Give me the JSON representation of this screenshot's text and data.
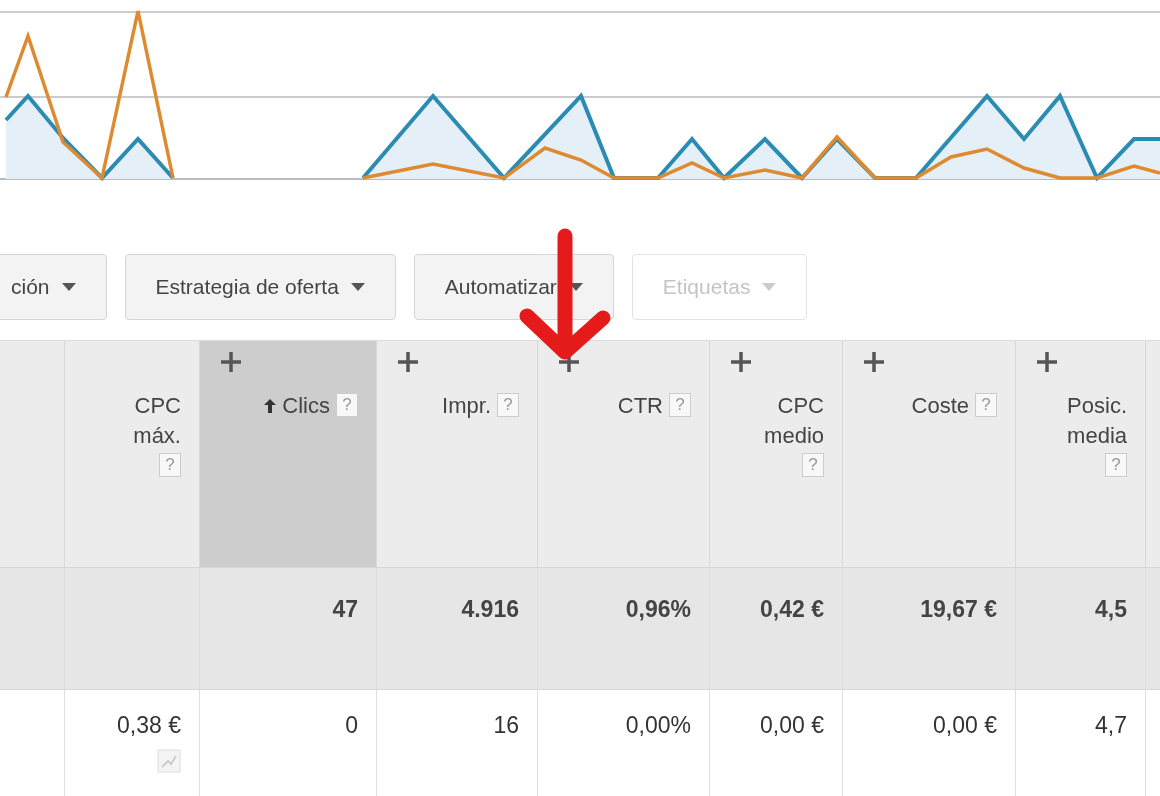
{
  "toolbar": {
    "buttons": [
      {
        "label": "ción",
        "disabled": false
      },
      {
        "label": "Estrategia de oferta",
        "disabled": false
      },
      {
        "label": "Automatizar",
        "disabled": false
      },
      {
        "label": "Etiquetas",
        "disabled": true
      }
    ]
  },
  "table": {
    "columns": [
      {
        "kind": "blank"
      },
      {
        "kind": "metric",
        "label": "CPC máx.",
        "help": "?",
        "addable": false,
        "sorted": false
      },
      {
        "kind": "metric",
        "label": "Clics",
        "help": "?",
        "addable": true,
        "sorted": true
      },
      {
        "kind": "metric",
        "label": "Impr.",
        "help": "?",
        "addable": true,
        "sorted": false
      },
      {
        "kind": "metric",
        "label": "CTR",
        "help": "?",
        "addable": true,
        "sorted": false
      },
      {
        "kind": "metric",
        "label": "CPC medio",
        "help": "?",
        "addable": true,
        "sorted": false
      },
      {
        "kind": "metric",
        "label": "Coste",
        "help": "?",
        "addable": true,
        "sorted": false
      },
      {
        "kind": "metric",
        "label": "Posic. media",
        "help": "?",
        "addable": true,
        "sorted": false
      },
      {
        "kind": "blank"
      }
    ],
    "rows": [
      {
        "kind": "total",
        "cells": [
          null,
          null,
          "47",
          "4.916",
          "0,96%",
          "0,42 €",
          "19,67 €",
          "4,5",
          null
        ]
      },
      {
        "kind": "data",
        "cells": [
          null,
          "0,38 €",
          "0",
          "16",
          "0,00%",
          "0,00 €",
          "0,00 €",
          "4,7",
          null
        ]
      }
    ]
  }
}
